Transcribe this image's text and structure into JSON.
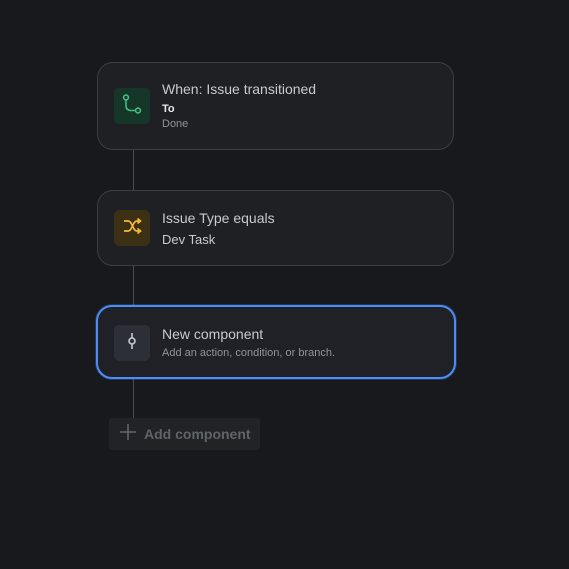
{
  "flow": {
    "trigger": {
      "title": "When: Issue transitioned",
      "field_label": "To",
      "field_value": "Done",
      "icon": "transition-icon",
      "accent": "#3fbf7f"
    },
    "condition": {
      "title": "Issue Type equals",
      "value": "Dev Task",
      "icon": "shuffle-icon",
      "accent": "#f5b93a"
    },
    "new_component": {
      "title": "New component",
      "hint": "Add an action, condition, or branch.",
      "icon": "component-node-icon",
      "accent": "#4c8df6"
    },
    "add_component": {
      "label": "Add component",
      "icon": "plus-icon"
    }
  }
}
